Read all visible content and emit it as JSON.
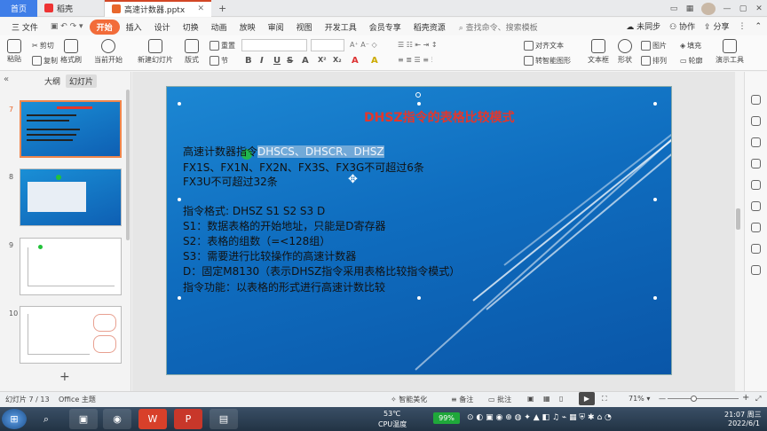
{
  "titlebar": {
    "home_tab": "首页",
    "doc_tab": "稻壳",
    "active_tab": "高速计数器.pptx",
    "new_tab": "+",
    "sidebar_toggle": "▭",
    "layout_btn": "▦",
    "minimize": "—",
    "maximize": "▢",
    "close": "✕"
  },
  "menubar": {
    "file": "三 文件",
    "items": [
      "开始",
      "插入",
      "设计",
      "切换",
      "动画",
      "放映",
      "审阅",
      "视图",
      "开发工具",
      "会员专享",
      "稻壳资源"
    ],
    "search": "查找命令、搜索模板",
    "sync": "未同步",
    "collab": "协作",
    "share": "分享"
  },
  "ribbon": {
    "paste": "粘贴",
    "cut": "剪切",
    "copy": "复制",
    "format_painter": "格式刷",
    "from_current": "当前开始",
    "new_slide": "新建幻灯片",
    "layout": "版式",
    "section": "节",
    "reset": "重置",
    "format_buttons": [
      "B",
      "I",
      "U",
      "S",
      "A",
      "X²",
      "X₂",
      "A",
      "A"
    ],
    "align_text": "对齐文本",
    "convert_smartart": "转智能图形",
    "textbox": "文本框",
    "shape": "形状",
    "picture": "图片",
    "fill": "填充",
    "arrange": "排列",
    "outline": "轮廓",
    "presenter_tools": "演示工具"
  },
  "leftpanel": {
    "outline_tab": "大纲",
    "slides_tab": "幻灯片",
    "thumbnails": [
      {
        "num": "7"
      },
      {
        "num": "8"
      },
      {
        "num": "9"
      },
      {
        "num": "10"
      }
    ],
    "add": "+"
  },
  "slide": {
    "title": "DHSZ指令的表格比较模式",
    "lines": [
      {
        "plain": "高速计数器指令",
        "highlight": "DHSCS、DHSCR、DHSZ"
      },
      {
        "plain": " FX1S、FX1N、FX2N、FX3S、FX3G不可超过6条"
      },
      {
        "plain": " FX3U不可超过32条"
      },
      {
        "plain": "指令格式:  DHSZ   S1   S2   S3   D"
      },
      {
        "plain": " S1：数据表格的开始地址，只能是D寄存器"
      },
      {
        "plain": " S2：表格的组数（=<128组）"
      },
      {
        "plain": " S3：需要进行比较操作的高速计数器"
      },
      {
        "plain": " D：固定M8130（表示DHSZ指令采用表格比较指令模式）"
      },
      {
        "plain": "指令功能：以表格的形式进行高速计数比较"
      }
    ]
  },
  "statusbar": {
    "slide_counter": "幻灯片 7 / 13",
    "theme": "Office 主题",
    "beautify": "智能美化",
    "notes": "备注",
    "comments": "批注",
    "zoom": "71%",
    "zoom_minus": "—",
    "zoom_plus": "+"
  },
  "taskbar": {
    "cpu_temp": "53℃",
    "cpu_label": "CPU温度",
    "battery": "99%",
    "time": "21:07 周三",
    "date": "2022/6/1"
  },
  "colors": {
    "accent": "#f26c3a",
    "home_tab": "#3f7ee8",
    "slide_title": "#e3372c",
    "slide_bg": "#1c87d3"
  }
}
